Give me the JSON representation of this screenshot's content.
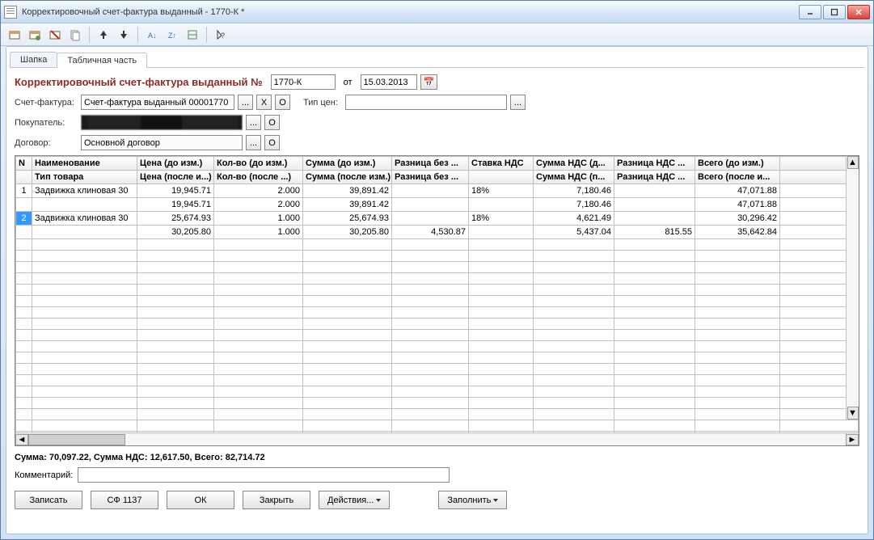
{
  "window": {
    "title": "Корректировочный счет-фактура выданный - 1770-К *"
  },
  "tabs": {
    "header": "Шапка",
    "table": "Табличная часть"
  },
  "header_form": {
    "title_prefix": "Корректировочный счет-фактура выданный №",
    "doc_number": "1770-К",
    "date_label": "от",
    "doc_date": "15.03.2013",
    "invoice_label": "Счет-фактура:",
    "invoice_value": "Счет-фактура выданный 00001770 |",
    "price_type_label": "Тип цен:",
    "price_type_value": "",
    "buyer_label": "Покупатель:",
    "contract_label": "Договор:",
    "contract_value": "Основной договор"
  },
  "grid": {
    "headers1": {
      "n": "N",
      "name": "Наименование",
      "price": "Цена (до изм.)",
      "qty": "Кол-во (до изм.)",
      "sum": "Сумма (до изм.)",
      "diff": "Разница без ...",
      "vat": "Ставка НДС",
      "vatsum": "Сумма НДС (д...",
      "vatdiff": "Разница НДС ...",
      "total": "Всего (до изм.)"
    },
    "headers2": {
      "name": "Тип товара",
      "price": "Цена (после и...)",
      "qty": "Кол-во (после ...)",
      "sum": "Сумма (после изм.)",
      "diff": "Разница без ...",
      "vatsum": "Сумма НДС (п...",
      "vatdiff": "Разница НДС ...",
      "total": "Всего (после и..."
    },
    "rows": [
      {
        "n": "1",
        "name": "Задвижка клиновая 30",
        "price": "19,945.71",
        "qty": "2.000",
        "sum": "39,891.42",
        "diff": "",
        "vat": "18%",
        "vatsum": "7,180.46",
        "vatdiff": "",
        "total": "47,071.88"
      },
      {
        "n": "",
        "name": "",
        "price": "19,945.71",
        "qty": "2.000",
        "sum": "39,891.42",
        "diff": "",
        "vat": "",
        "vatsum": "7,180.46",
        "vatdiff": "",
        "total": "47,071.88"
      },
      {
        "n": "2",
        "name": "Задвижка клиновая 30",
        "price": "25,674.93",
        "qty": "1.000",
        "sum": "25,674.93",
        "diff": "",
        "vat": "18%",
        "vatsum": "4,621.49",
        "vatdiff": "",
        "total": "30,296.42",
        "hl": true
      },
      {
        "n": "",
        "name": "",
        "price": "30,205.80",
        "qty": "1.000",
        "sum": "30,205.80",
        "diff": "4,530.87",
        "vat": "",
        "vatsum": "5,437.04",
        "vatdiff": "815.55",
        "total": "35,642.84"
      }
    ]
  },
  "summary": "Сумма: 70,097.22, Сумма НДС: 12,617.50, Всего: 82,714.72",
  "comment_label": "Комментарий:",
  "comment_value": "",
  "buttons": {
    "save": "Записать",
    "sf": "СФ 1137",
    "ok": "ОК",
    "close": "Закрыть",
    "actions": "Действия...",
    "fill": "Заполнить"
  },
  "small": {
    "dots": "...",
    "x": "X",
    "list": "O",
    "cal": "📅"
  }
}
